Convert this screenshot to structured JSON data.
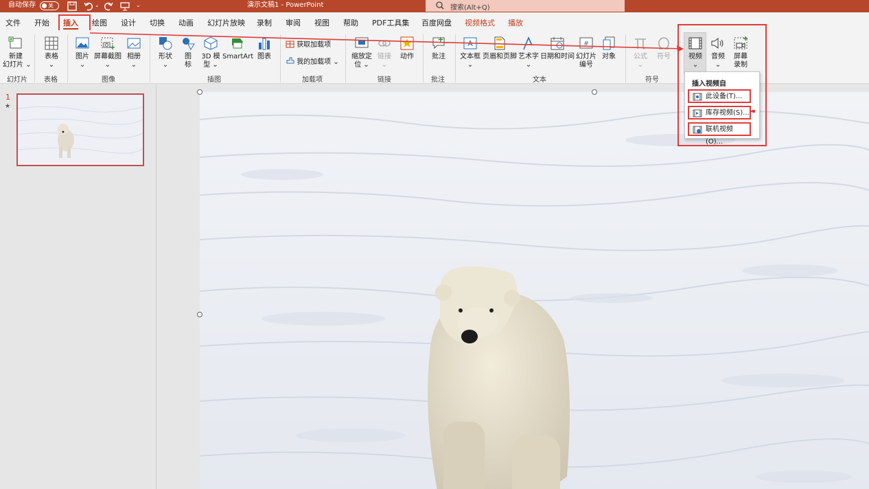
{
  "titlebar": {
    "autosave_label": "自动保存",
    "autosave_state": "关",
    "doc_title": "演示文稿1  -  PowerPoint",
    "search_placeholder": "搜索(Alt+Q)"
  },
  "menu_tabs": [
    "文件",
    "开始",
    "插入",
    "绘图",
    "设计",
    "切换",
    "动画",
    "幻灯片放映",
    "录制",
    "审阅",
    "视图",
    "帮助",
    "PDF工具集",
    "百度网盘",
    "视频格式",
    "播放"
  ],
  "active_tab": "插入",
  "ribbon": {
    "new_slide": "新建\n幻灯片",
    "table": "表格",
    "picture": "图片",
    "screenshot": "屏幕截图",
    "album": "相册",
    "shapes": "形状",
    "icons": "图\n标",
    "model3d": "3D 模\n型",
    "smartart": "SmartArt",
    "chart": "图表",
    "get_addins": "获取加载项",
    "my_addins": "我的加载项",
    "zoom": "缩放定\n位",
    "link": "链接",
    "action": "动作",
    "comment": "批注",
    "textbox": "文本框",
    "header_footer": "页眉和页脚",
    "wordart": "艺术字",
    "datetime": "日期和时间",
    "slide_number": "幻灯片\n编号",
    "object": "对象",
    "equation": "公式",
    "symbol": "符号",
    "video": "视频",
    "audio": "音频",
    "screen_record": "屏幕\n录制",
    "groups": {
      "slides": "幻灯片",
      "tables": "表格",
      "images": "图像",
      "illustrations": "插图",
      "addins": "加载项",
      "links": "链接",
      "comments": "批注",
      "text": "文本",
      "symbols": "符号"
    }
  },
  "video_dropdown": {
    "header": "插入视频自",
    "items": [
      "此设备(T)...",
      "库存视频(S)...",
      "联机视频(O)..."
    ]
  },
  "thumbnails": {
    "number": "1",
    "star": "★"
  },
  "colors": {
    "accent": "#b7472a",
    "highlight": "#e23b3b"
  }
}
